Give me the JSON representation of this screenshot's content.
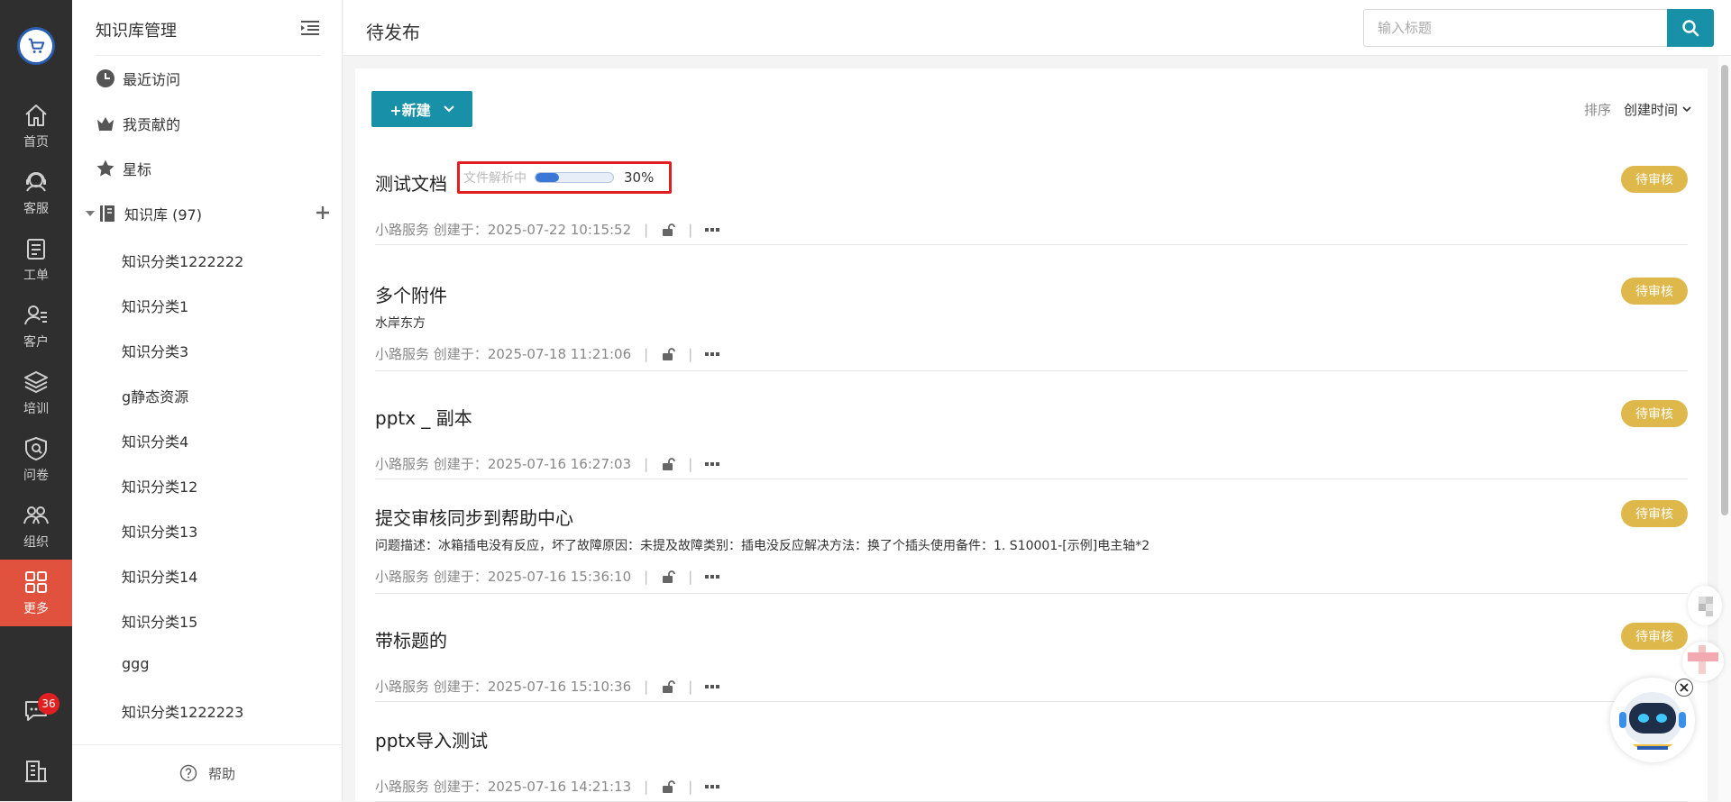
{
  "rail": {
    "items": [
      {
        "label": "首页",
        "icon": "home-icon"
      },
      {
        "label": "客服",
        "icon": "headset-icon"
      },
      {
        "label": "工单",
        "icon": "clipboard-icon"
      },
      {
        "label": "客户",
        "icon": "customer-icon"
      },
      {
        "label": "培训",
        "icon": "layers-icon"
      },
      {
        "label": "问卷",
        "icon": "survey-icon"
      },
      {
        "label": "组织",
        "icon": "organization-icon"
      },
      {
        "label": "更多",
        "icon": "grid-icon",
        "active": true
      }
    ],
    "message_badge": "36",
    "accent_color": "#e0523e"
  },
  "panel": {
    "title": "知识库管理",
    "nav": {
      "recent": "最近访问",
      "contributed": "我贡献的",
      "starred": "星标",
      "kb": "知识库 (97)"
    },
    "categories": [
      "知识分类1222222",
      "知识分类1",
      "知识分类3",
      "g静态资源",
      "知识分类4",
      "知识分类12",
      "知识分类13",
      "知识分类14",
      "知识分类15",
      "ggg",
      "知识分类1222223"
    ],
    "help": "帮助"
  },
  "header": {
    "title": "待发布",
    "search_placeholder": "输入标题"
  },
  "toolbar": {
    "new_label": "+新建",
    "sort_label": "排序",
    "sort_value": "创建时间"
  },
  "docs": [
    {
      "title": "测试文档",
      "desc": "",
      "author": "小路服务",
      "created_prefix": "创建于：",
      "created": "2025-07-22 10:15:52",
      "status": "待审核",
      "parsing": {
        "text": "文件解析中",
        "percent": 30,
        "percent_label": "30%"
      }
    },
    {
      "title": "多个附件",
      "desc": "水岸东方",
      "author": "小路服务",
      "created_prefix": "创建于：",
      "created": "2025-07-18 11:21:06",
      "status": "待审核"
    },
    {
      "title": "pptx _ 副本",
      "desc": "",
      "author": "小路服务",
      "created_prefix": "创建于：",
      "created": "2025-07-16 16:27:03",
      "status": "待审核"
    },
    {
      "title": "提交审核同步到帮助中心",
      "desc": "问题描述：冰箱插电没有反应，坏了故障原因：未提及故障类别：插电没反应解决方法：换了个插头使用备件：1. S10001-[示例]电主轴*2",
      "author": "小路服务",
      "created_prefix": "创建于：",
      "created": "2025-07-16 15:36:10",
      "status": "待审核"
    },
    {
      "title": "带标题的",
      "desc": "",
      "author": "小路服务",
      "created_prefix": "创建于：",
      "created": "2025-07-16 15:10:36",
      "status": "待审核"
    },
    {
      "title": "pptx导入测试",
      "desc": "",
      "author": "小路服务",
      "created_prefix": "创建于：",
      "created": "2025-07-16 14:21:13",
      "status": ""
    }
  ],
  "colors": {
    "primary": "#1790a8",
    "status_pending": "#dfb84b",
    "highlight_border": "#e02020"
  }
}
